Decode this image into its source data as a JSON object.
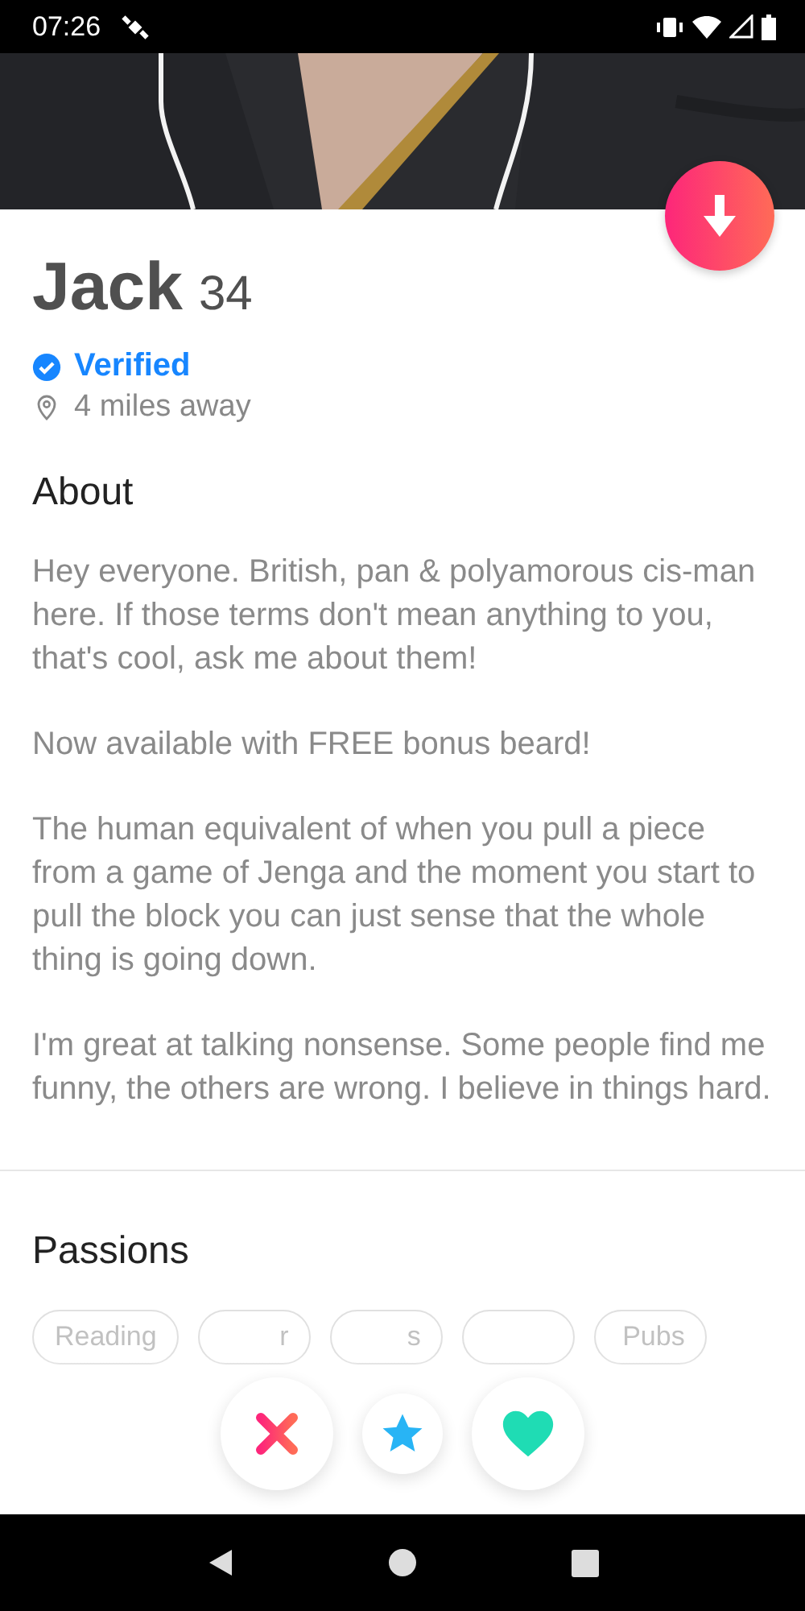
{
  "status_bar": {
    "time": "07:26"
  },
  "profile": {
    "name": "Jack",
    "age": "34",
    "verified": true,
    "verified_label": "Verified",
    "distance": "4 miles away"
  },
  "about": {
    "heading": "About",
    "paragraphs": [
      "Hey everyone. British, pan & polyamorous cis-man here. If those terms don't mean anything to you, that's cool, ask me about them!",
      "Now available with FREE bonus beard!",
      "The human equivalent of when you pull a piece from a game of Jenga and the moment you start to pull the block you can just sense that the whole thing is going down.",
      "I'm great at talking nonsense. Some people find me funny, the others are wrong. I believe in things hard."
    ]
  },
  "passions": {
    "heading": "Passions",
    "chips": [
      {
        "kind": "text",
        "label": "Reading"
      },
      {
        "kind": "text",
        "label": "r"
      },
      {
        "kind": "text",
        "label": "s"
      },
      {
        "kind": "covered"
      },
      {
        "kind": "text",
        "label": "Pubs"
      }
    ]
  },
  "actions": [
    {
      "kind": "nope"
    },
    {
      "kind": "super"
    },
    {
      "kind": "like"
    }
  ]
}
